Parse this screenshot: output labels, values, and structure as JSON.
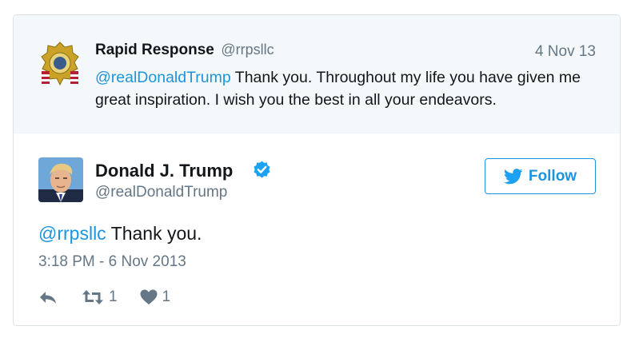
{
  "quoted": {
    "name": "Rapid Response",
    "handle": "@rrpsllc",
    "date": "4 Nov 13",
    "mention": "@realDonaldTrump",
    "text": " Thank you. Throughout my life you have given me great inspiration. I wish you the best in all your endeavors."
  },
  "tweet": {
    "name": "Donald J. Trump",
    "handle": "@realDonaldTrump",
    "follow_label": "Follow",
    "mention": "@rrpsllc",
    "text": " Thank you.",
    "timestamp": "3:18 PM - 6 Nov 2013",
    "retweet_count": "1",
    "like_count": "1"
  },
  "icons": {
    "verified": "verified-badge-icon",
    "bird": "twitter-bird-icon",
    "reply": "reply-icon",
    "retweet": "retweet-icon",
    "like": "heart-icon"
  },
  "colors": {
    "accent": "#1b95e0",
    "muted": "#657786",
    "quoted_bg": "#f5f8fa"
  }
}
